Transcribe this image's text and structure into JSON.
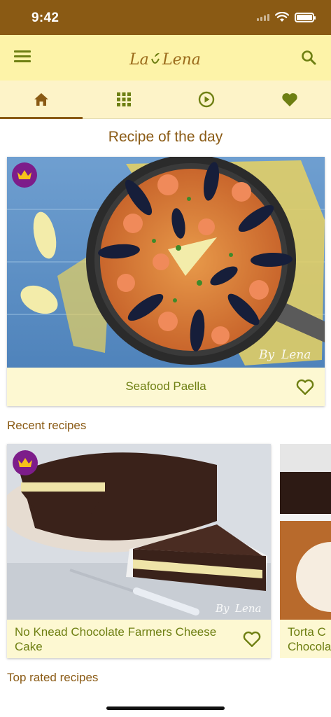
{
  "status_bar": {
    "time": "9:42"
  },
  "app": {
    "logo_text": "La Lena"
  },
  "tabs": [
    {
      "icon": "home-icon",
      "active": true
    },
    {
      "icon": "grid-icon",
      "active": false
    },
    {
      "icon": "play-circle-icon",
      "active": false
    },
    {
      "icon": "heart-icon",
      "active": false
    }
  ],
  "recipe_of_day": {
    "section_title": "Recipe of the day",
    "name": "Seafood Paella",
    "premium": true,
    "watermark": "By Lena"
  },
  "recent": {
    "section_title": "Recent recipes",
    "items": [
      {
        "name": "No Knead Chocolate Farmers Cheese Cake",
        "premium": true,
        "watermark": "By Lena"
      },
      {
        "name": "Torta C Chocola",
        "premium": false
      }
    ]
  },
  "top_rated": {
    "section_title": "Top rated recipes"
  },
  "colors": {
    "status_bar": "#8a5a14",
    "header_bg": "#fdf3a8",
    "accent_green": "#6e7f12",
    "accent_brown": "#8a5a14",
    "premium_badge": "#7d1d8a"
  }
}
